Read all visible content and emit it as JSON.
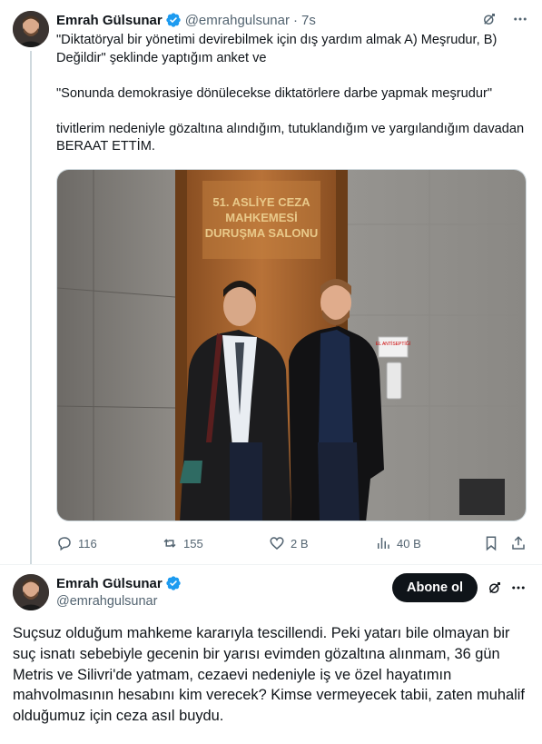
{
  "tweet": {
    "author_name": "Emrah Gülsunar",
    "handle": "@emrahgulsunar",
    "separator": "·",
    "time": "7s",
    "paragraphs": [
      "\"Diktatöryal bir yönetimi devirebilmek için dış yardım almak A) Meşrudur, B) Değildir\" şeklinde yaptığım anket ve",
      "\"Sonunda demokrasiye dönülecekse diktatörlere darbe yapmak meşrudur\"",
      "tivitlerim nedeniyle gözaltına alındığım, tutuklandığım ve yargılandığım davadan BERAAT ETTİM."
    ],
    "photo": {
      "sign_line1": "51. ASLİYE CEZA",
      "sign_line2": "MAHKEMESİ",
      "sign_line3": "DURUŞMA SALONU",
      "wall_label": "EL ANTİSEPTİĞİ"
    },
    "actions": {
      "replies": "116",
      "reposts": "155",
      "likes": "2 B",
      "views": "40 B"
    }
  },
  "post": {
    "author_name": "Emrah Gülsunar",
    "handle": "@emrahgulsunar",
    "follow_label": "Abone ol",
    "text": "Suçsuz olduğum mahkeme kararıyla tescillendi. Peki yatarı bile olmayan bir suç isnatı sebebiyle gecenin bir yarısı evimden gözaltına alınmam, 36 gün Metris ve Silivri'de yatmam, cezaevi nedeniyle iş ve özel hayatımın mahvolmasının hesabını kim verecek? Kimse vermeyecek tabii, zaten muhalif olduğumuz için ceza asıl buydu."
  },
  "icons": {
    "verified": "verified-badge-icon",
    "grok": "grok-icon",
    "more": "more-icon",
    "reply": "reply-icon",
    "repost": "repost-icon",
    "like": "heart-icon",
    "views": "views-chart-icon",
    "bookmark": "bookmark-icon",
    "share": "share-icon"
  },
  "colors": {
    "verified": "#1d9bf0",
    "text": "#0f1419",
    "secondary": "#536471",
    "button_bg": "#0f1419"
  }
}
